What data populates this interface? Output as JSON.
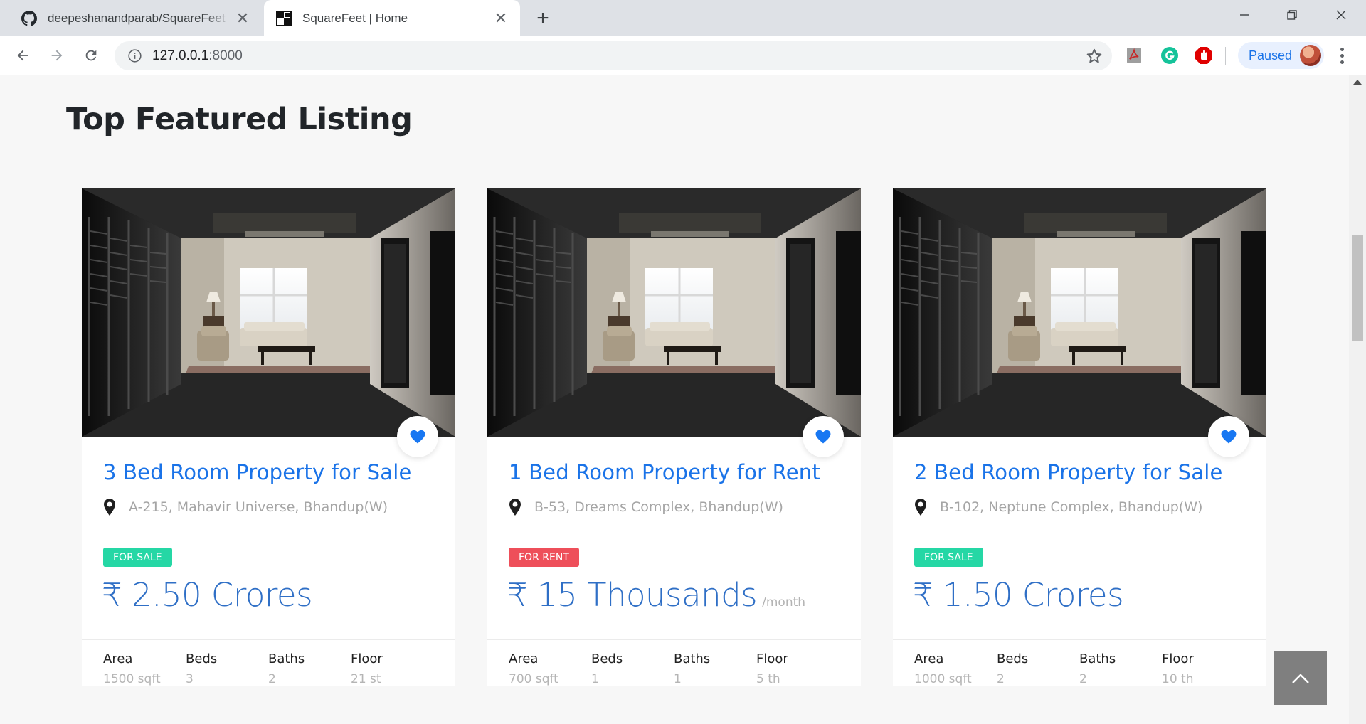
{
  "browser": {
    "tabs": [
      {
        "title": "deepeshanandparab/SquareFeet",
        "icon": "github-icon",
        "active": false
      },
      {
        "title": "SquareFeet | Home",
        "icon": "squarefeet-favicon",
        "active": true
      }
    ],
    "address": {
      "host": "127.0.0.1",
      "port": ":8000"
    },
    "profile_label": "Paused"
  },
  "page": {
    "section_title": "Top Featured Listing",
    "listings": [
      {
        "title": "3 Bed Room Property for Sale",
        "address": "A-215, Mahavir Universe, Bhandup(W)",
        "badge": "FOR SALE",
        "price": "₹ 2.50 Crores",
        "price_suffix": "",
        "specs": {
          "area_label": "Area",
          "area": "1500 sqft",
          "beds_label": "Beds",
          "beds": "3",
          "baths_label": "Baths",
          "baths": "2",
          "floor_label": "Floor",
          "floor": "21 st"
        }
      },
      {
        "title": "1 Bed Room Property for Rent",
        "address": "B-53, Dreams Complex, Bhandup(W)",
        "badge": "FOR RENT",
        "price": "₹ 15 Thousands",
        "price_suffix": "/month",
        "specs": {
          "area_label": "Area",
          "area": "700 sqft",
          "beds_label": "Beds",
          "beds": "1",
          "baths_label": "Baths",
          "baths": "1",
          "floor_label": "Floor",
          "floor": "5 th"
        }
      },
      {
        "title": "2 Bed Room Property for Sale",
        "address": "B-102, Neptune Complex, Bhandup(W)",
        "badge": "FOR SALE",
        "price": "₹ 1.50 Crores",
        "price_suffix": "",
        "specs": {
          "area_label": "Area",
          "area": "1000 sqft",
          "beds_label": "Beds",
          "beds": "2",
          "baths_label": "Baths",
          "baths": "2",
          "floor_label": "Floor",
          "floor": "10 th"
        }
      }
    ]
  },
  "colors": {
    "title_blue": "#1a73e8",
    "sale_badge": "#25d7a5",
    "rent_badge": "#ee4f5a",
    "heart": "#1877f2",
    "to_top_button": "#7f7f7f"
  }
}
